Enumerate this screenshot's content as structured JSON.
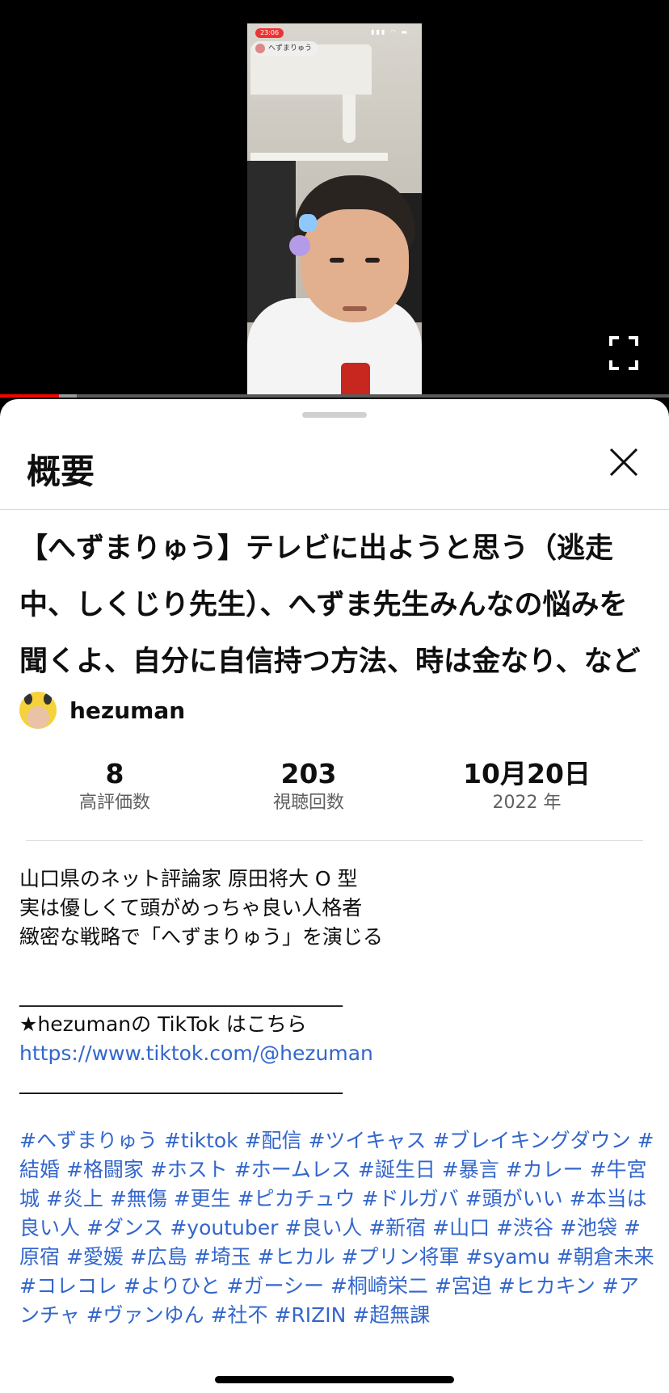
{
  "video": {
    "status_time": "23:06",
    "status_icons": "▮▮▮ ◠ ▬",
    "live_chip_name": "へずまりゅう",
    "progress_fraction": 0.088,
    "buffer_fraction": 0.115
  },
  "sheet": {
    "title": "概要",
    "video_title": "【へずまりゅう】テレビに出ようと思う（逃走中、しくじり先生）、へずま先生みんなの悩みを聞くよ、自分に自信持つ方法、時は金なり、など",
    "channel_name": "hezuman",
    "stats": {
      "likes_value": "8",
      "likes_label": "高評価数",
      "views_value": "203",
      "views_label": "視聴回数",
      "date_value": "10月20日",
      "date_label": "2022 年"
    },
    "description": {
      "line1": "山口県のネット評論家 原田将大 O 型",
      "line2": "実は優しくて頭がめっちゃ良い人格者",
      "line3": "緻密な戦略で「へずまりゅう」を演じる",
      "separator1": "________________________________",
      "tiktok_intro": "★hezumanの TikTok はこちら",
      "tiktok_link": "https://www.tiktok.com/@hezuman",
      "separator2": "________________________________",
      "hashtags": "#へずまりゅう #tiktok #配信 #ツイキャス #ブレイキングダウン #結婚 #格闘家 #ホスト #ホームレス #誕生日 #暴言 #カレー #牛宮城 #炎上 #無傷 #更生 #ピカチュウ #ドルガバ #頭がいい #本当は良い人 #ダンス #youtuber #良い人 #新宿 #山口 #渋谷 #池袋 #原宿 #愛媛 #広島 #埼玉 #ヒカル #プリン将軍 #syamu #朝倉未来 #コレコレ #よりひと #ガーシー #桐崎栄二 #宮迫 #ヒカキン #アンチャ #ヴァンゆん #社不 #RIZIN #超無課"
    }
  }
}
